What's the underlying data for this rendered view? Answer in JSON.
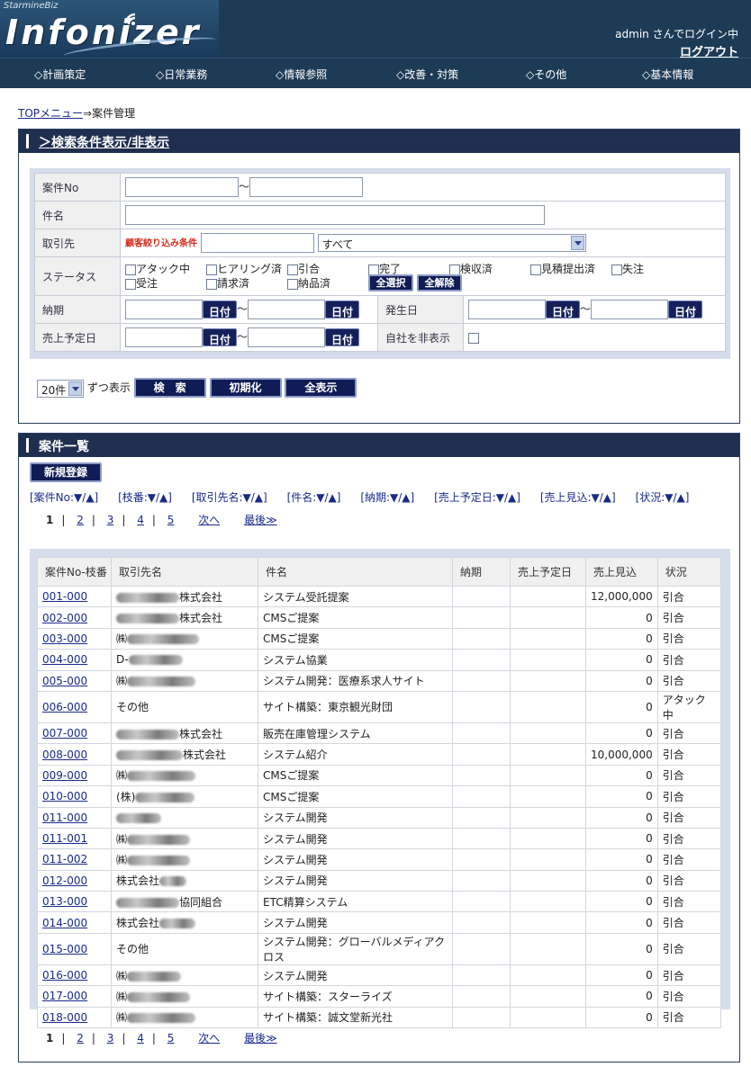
{
  "header": {
    "brand_small": "StarmineBiz",
    "brand_name": "Infonizer",
    "user_text": "admin さんでログイン中",
    "logout": "ログアウト"
  },
  "nav": [
    "◇計画策定",
    "◇日常業務",
    "◇情報参照",
    "◇改善・対策",
    "◇その他",
    "◇基本情報"
  ],
  "breadcrumb": {
    "top": "TOPメニュー",
    "arrow": "⇒",
    "current": "案件管理"
  },
  "search": {
    "toggle": "＞検索条件表示/非表示",
    "labels": {
      "case_no": "案件No",
      "name": "件名",
      "client": "取引先",
      "status": "ステータス",
      "due": "納期",
      "occur": "発生日",
      "sales_date": "売上予定日",
      "hide_own": "自社を非表示"
    },
    "tilde": "～",
    "client_filter_label": "顧客絞り込み条件",
    "client_select": "すべて",
    "statuses": [
      "アタック中",
      "ヒアリング済",
      "引合",
      "完了",
      "検収済",
      "見積提出済",
      "失注",
      "受注",
      "請求済",
      "納品済"
    ],
    "select_all": "全選択",
    "deselect_all": "全解除",
    "date_btn": "日付",
    "per_page": "20件",
    "per_page_suffix": "ずつ表示",
    "btn_search": "検　索",
    "btn_reset": "初期化",
    "btn_all": "全表示"
  },
  "list": {
    "title": "案件一覧",
    "new_button": "新規登録",
    "sort_labels": [
      "[案件No:▼/▲]",
      "[枝番:▼/▲]",
      "[取引先名:▼/▲]",
      "[件名:▼/▲]",
      "[納期:▼/▲]",
      "[売上予定日:▼/▲]",
      "[売上見込:▼/▲]",
      "[状況:▼/▲]"
    ],
    "pager": {
      "pages": [
        "1",
        "2",
        "3",
        "4",
        "5"
      ],
      "next": "次へ",
      "last": "最後≫",
      "sep": "|"
    },
    "columns": [
      "案件No-枝番",
      "取引先名",
      "件名",
      "納期",
      "売上予定日",
      "売上見込",
      "状況"
    ],
    "rows": [
      {
        "no": "001-000",
        "client": "株式会社",
        "subject": "システム受託提案",
        "due": "",
        "sales": "",
        "amount": "12,000,000",
        "status": "引合"
      },
      {
        "no": "002-000",
        "client": "株式会社",
        "subject": "CMSご提案",
        "due": "",
        "sales": "",
        "amount": "0",
        "status": "引合"
      },
      {
        "no": "003-000",
        "client": "㈱",
        "subject": "CMSご提案",
        "due": "",
        "sales": "",
        "amount": "0",
        "status": "引合"
      },
      {
        "no": "004-000",
        "client": "D-",
        "subject": "システム協業",
        "due": "",
        "sales": "",
        "amount": "0",
        "status": "引合"
      },
      {
        "no": "005-000",
        "client": "㈱",
        "subject": "システム開発：医療系求人サイト",
        "due": "",
        "sales": "",
        "amount": "0",
        "status": "引合"
      },
      {
        "no": "006-000",
        "client": "その他",
        "subject": "サイト構築：東京観光財団",
        "due": "",
        "sales": "",
        "amount": "0",
        "status": "アタック中"
      },
      {
        "no": "007-000",
        "client": "株式会社",
        "subject": "販売在庫管理システム",
        "due": "",
        "sales": "",
        "amount": "0",
        "status": "引合"
      },
      {
        "no": "008-000",
        "client": "株式会社",
        "subject": "システム紹介",
        "due": "",
        "sales": "",
        "amount": "10,000,000",
        "status": "引合"
      },
      {
        "no": "009-000",
        "client": "㈱",
        "subject": "CMSご提案",
        "due": "",
        "sales": "",
        "amount": "0",
        "status": "引合"
      },
      {
        "no": "010-000",
        "client": "(株)",
        "subject": "CMSご提案",
        "due": "",
        "sales": "",
        "amount": "0",
        "status": "引合"
      },
      {
        "no": "011-000",
        "client": "",
        "subject": "システム開発",
        "due": "",
        "sales": "",
        "amount": "0",
        "status": "引合"
      },
      {
        "no": "011-001",
        "client": "㈱",
        "subject": "システム開発",
        "due": "",
        "sales": "",
        "amount": "0",
        "status": "引合"
      },
      {
        "no": "011-002",
        "client": "㈱",
        "subject": "システム開発",
        "due": "",
        "sales": "",
        "amount": "0",
        "status": "引合"
      },
      {
        "no": "012-000",
        "client": "株式会社",
        "subject": "システム開発",
        "due": "",
        "sales": "",
        "amount": "0",
        "status": "引合"
      },
      {
        "no": "013-000",
        "client": "協同組合",
        "subject": "ETC精算システム",
        "due": "",
        "sales": "",
        "amount": "0",
        "status": "引合"
      },
      {
        "no": "014-000",
        "client": "株式会社",
        "subject": "システム開発",
        "due": "",
        "sales": "",
        "amount": "0",
        "status": "引合"
      },
      {
        "no": "015-000",
        "client": "その他",
        "subject": "システム開発：グローバルメディアクロス",
        "due": "",
        "sales": "",
        "amount": "0",
        "status": "引合"
      },
      {
        "no": "016-000",
        "client": "㈱",
        "subject": "システム開発",
        "due": "",
        "sales": "",
        "amount": "0",
        "status": "引合"
      },
      {
        "no": "017-000",
        "client": "㈱",
        "subject": "サイト構築：スターライズ",
        "due": "",
        "sales": "",
        "amount": "0",
        "status": "引合"
      },
      {
        "no": "018-000",
        "client": "㈱",
        "subject": "サイト構築：誠文堂新光社",
        "due": "",
        "sales": "",
        "amount": "0",
        "status": "引合"
      }
    ]
  }
}
